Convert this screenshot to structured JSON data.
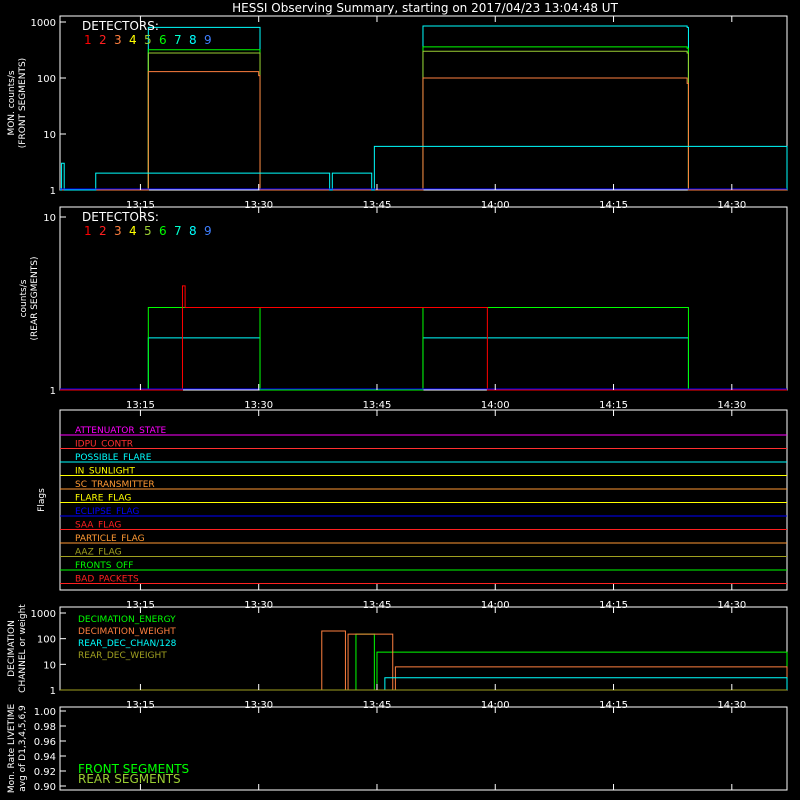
{
  "title": "HESSI Observing Summary, starting on 2017/04/23 13:04:48 UT",
  "colors": {
    "background": "#000000",
    "axes": "#ffffff",
    "det": [
      "#ff0000",
      "#ff2020",
      "#ff7f3f",
      "#ffff00",
      "#9acd32",
      "#00ff00",
      "#00ffcc",
      "#00ffff",
      "#3f7fff",
      "#0000ff"
    ]
  },
  "x_axis": {
    "ticks": [
      "13:15",
      "13:30",
      "13:45",
      "14:00",
      "14:15",
      "14:30"
    ]
  },
  "panels": [
    {
      "id": "front",
      "ylabel_lines": [
        "MON. counts/s",
        "(FRONT SEGMENTS)"
      ],
      "yticks": [
        "1",
        "10",
        "100",
        "1000"
      ],
      "legend_title": "DETECTORS:",
      "legend_digits": [
        "1",
        "2",
        "3",
        "4",
        "5",
        "6",
        "7",
        "8",
        "9"
      ]
    },
    {
      "id": "rear",
      "ylabel_lines": [
        "counts/s",
        "(REAR SEGMENTS)"
      ],
      "yticks": [
        "1",
        "10"
      ],
      "legend_title": "DETECTORS:",
      "legend_digits": [
        "1",
        "2",
        "3",
        "4",
        "5",
        "6",
        "7",
        "8",
        "9"
      ]
    },
    {
      "id": "flags",
      "ylabel_lines": [
        "Flags"
      ],
      "flags": [
        "ATTENUATOR_STATE",
        "IDPU_CONTR",
        "POSSIBLE_FLARE",
        "IN_SUNLIGHT",
        "SC_TRANSMITTER",
        "FLARE_FLAG",
        "ECLIPSE_FLAG",
        "SAA_FLAG",
        "PARTICLE_FLAG",
        "AAZ_FLAG",
        "FRONTS_OFF",
        "BAD_PACKETS"
      ]
    },
    {
      "id": "decim",
      "ylabel_lines": [
        "DECIMATION",
        "CHANNEL or weight"
      ],
      "yticks": [
        "1",
        "10",
        "100",
        "1000"
      ],
      "labels": [
        "DECIMATION_ENERGY",
        "DECIMATION_WEIGHT",
        "REAR_DEC_CHAN/128",
        "REAR_DEC_WEIGHT"
      ]
    },
    {
      "id": "livetime",
      "ylabel_lines": [
        "Mon. Rate LIVETIME",
        "avg of D1,3,4,5,6,9"
      ],
      "yticks": [
        "0.90",
        "0.92",
        "0.94",
        "0.96",
        "0.98",
        "1.00"
      ],
      "labels": [
        "FRONT SEGMENTS",
        "REAR SEGMENTS"
      ]
    }
  ],
  "chart_data": [
    {
      "type": "line",
      "title": "HESSI Observing Summary, starting on 2017/04/23 13:04:48 UT",
      "ylabel": "MON. counts/s (FRONT SEGMENTS)",
      "yscale": "log",
      "ylim": [
        1,
        1000
      ],
      "xlim": [
        "13:04:48",
        "14:37:00"
      ],
      "series": [
        {
          "name": "7",
          "x": [
            "13:04:48",
            "13:15:50",
            "13:16:00",
            "13:30:00",
            "13:30:10",
            "13:50:40",
            "13:50:50",
            "14:24:20",
            "14:24:30",
            "14:37:00"
          ],
          "values": [
            1,
            1,
            800,
            800,
            1,
            1,
            850,
            800,
            1,
            1
          ]
        },
        {
          "name": "6",
          "x": [
            "13:04:48",
            "13:15:50",
            "13:16:00",
            "13:30:00",
            "13:30:10",
            "13:50:40",
            "13:50:50",
            "14:24:20",
            "14:24:30",
            "14:37:00"
          ],
          "values": [
            1,
            1,
            320,
            320,
            1,
            1,
            360,
            340,
            1,
            1
          ]
        },
        {
          "name": "5",
          "x": [
            "13:04:48",
            "13:15:50",
            "13:16:00",
            "13:30:00",
            "13:30:10",
            "13:50:40",
            "13:50:50",
            "14:24:20",
            "14:24:30",
            "14:37:00"
          ],
          "values": [
            1,
            1,
            280,
            280,
            1,
            1,
            300,
            280,
            1,
            1
          ]
        },
        {
          "name": "3",
          "x": [
            "13:04:48",
            "13:15:50",
            "13:16:00",
            "13:30:00",
            "13:30:10",
            "13:50:40",
            "13:50:50",
            "14:24:20",
            "14:24:30",
            "14:37:00"
          ],
          "values": [
            1,
            1,
            130,
            110,
            1,
            1,
            100,
            80,
            1,
            1
          ]
        },
        {
          "name": "8",
          "x": [
            "13:04:48",
            "13:05:00",
            "13:05:20",
            "13:09:00",
            "13:09:20",
            "13:39:00",
            "13:39:20",
            "13:44:20",
            "13:44:40",
            "14:37:00"
          ],
          "values": [
            1,
            3,
            1,
            1,
            2,
            1,
            2,
            1,
            6,
            1
          ]
        }
      ]
    },
    {
      "type": "line",
      "ylabel": "counts/s (REAR SEGMENTS)",
      "yscale": "log",
      "ylim": [
        1,
        10
      ],
      "xlim": [
        "13:04:48",
        "14:37:00"
      ],
      "series": [
        {
          "name": "7",
          "x": [
            "13:04:48",
            "13:15:50",
            "13:16:00",
            "13:30:00",
            "13:30:10",
            "13:50:40",
            "13:50:50",
            "14:24:20",
            "14:24:30",
            "14:37:00"
          ],
          "values": [
            1,
            1,
            2,
            2,
            1,
            1,
            2,
            2,
            1,
            1
          ]
        },
        {
          "name": "6",
          "x": [
            "13:04:48",
            "13:15:50",
            "13:16:00",
            "13:30:00",
            "13:30:10",
            "13:50:40",
            "13:50:50",
            "14:24:20",
            "14:24:30",
            "14:37:00"
          ],
          "values": [
            1,
            1,
            3,
            3,
            1,
            1,
            3,
            3,
            1,
            1
          ]
        },
        {
          "name": "1",
          "x": [
            "13:04:48",
            "13:20:00",
            "13:20:20",
            "13:20:40",
            "13:59:00",
            "14:37:00"
          ],
          "values": [
            1,
            1,
            4,
            3,
            1,
            1
          ]
        }
      ]
    },
    {
      "type": "line",
      "ylabel": "DECIMATION CHANNEL or weight",
      "yscale": "log",
      "ylim": [
        1,
        1000
      ],
      "xlim": [
        "13:04:48",
        "14:37:00"
      ],
      "series": [
        {
          "name": "DECIMATION_ENERGY",
          "x": [
            "13:04:48",
            "13:42:00",
            "13:42:20",
            "13:44:40",
            "13:45:00",
            "14:37:00"
          ],
          "values": [
            1,
            1,
            150,
            1,
            30,
            1
          ]
        },
        {
          "name": "DECIMATION_WEIGHT",
          "x": [
            "13:04:48",
            "13:37:40",
            "13:38:00",
            "13:41:00",
            "13:41:20",
            "13:47:00",
            "13:47:20",
            "14:37:00"
          ],
          "values": [
            1,
            1,
            200,
            1,
            150,
            1,
            8,
            1
          ]
        },
        {
          "name": "REAR_DEC_CHAN/128",
          "x": [
            "13:04:48",
            "13:45:40",
            "13:46:00",
            "14:37:00"
          ],
          "values": [
            1,
            1,
            3,
            1
          ]
        },
        {
          "name": "REAR_DEC_WEIGHT",
          "x": [
            "13:04:48",
            "14:37:00"
          ],
          "values": [
            1,
            1
          ]
        }
      ]
    },
    {
      "type": "line",
      "ylabel": "Mon. Rate LIVETIME avg of D1,3,4,5,6,9",
      "ylim": [
        0.9,
        1.0
      ],
      "series": [
        {
          "name": "FRONT SEGMENTS",
          "values": []
        },
        {
          "name": "REAR SEGMENTS",
          "values": []
        }
      ]
    }
  ]
}
